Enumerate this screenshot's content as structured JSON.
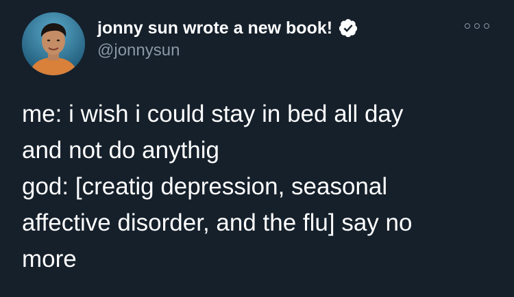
{
  "tweet": {
    "author": {
      "display_name": "jonny sun wrote a new book!",
      "handle": "@jonnysun",
      "verified": true,
      "avatar": "profile-photo"
    },
    "more_icon": "ellipsis-icon",
    "text_lines": [
      "me: i wish i could stay in bed all day",
      "and not do anythig",
      "god: [creatig depression, seasonal",
      "affective disorder, and the flu] say no",
      "more"
    ]
  },
  "colors": {
    "background": "#15202b",
    "primary_text": "#ffffff",
    "secondary_text": "#8b98a5"
  }
}
